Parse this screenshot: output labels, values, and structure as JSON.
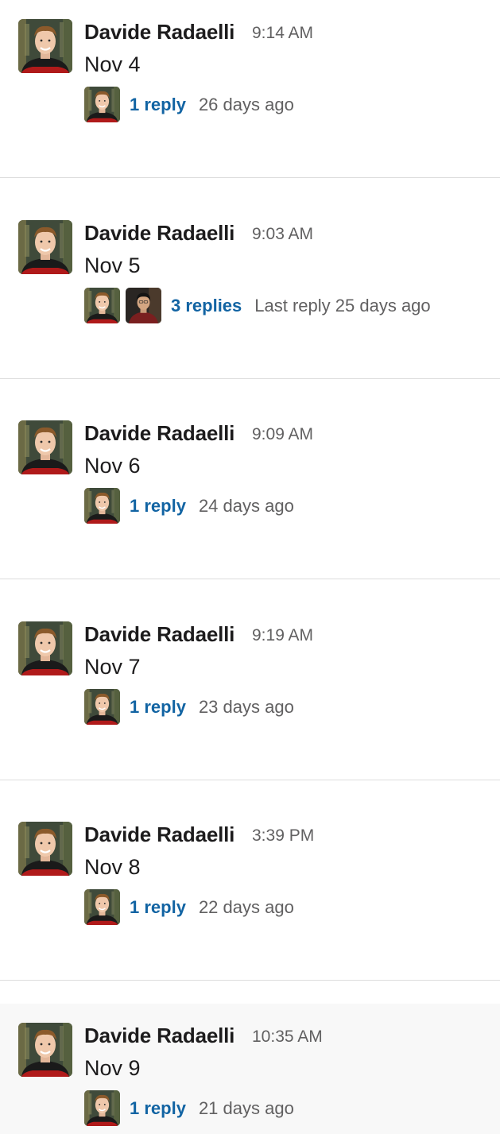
{
  "messages": [
    {
      "author": "Davide Radaelli",
      "time": "9:14 AM",
      "text": "Nov 4",
      "replies": "1 reply",
      "reply_meta": "26 days ago",
      "participants": [
        "davide"
      ]
    },
    {
      "author": "Davide Radaelli",
      "time": "9:03 AM",
      "text": "Nov 5",
      "replies": "3 replies",
      "reply_meta": "Last reply 25 days ago",
      "participants": [
        "davide",
        "other"
      ]
    },
    {
      "author": "Davide Radaelli",
      "time": "9:09 AM",
      "text": "Nov 6",
      "replies": "1 reply",
      "reply_meta": "24 days ago",
      "participants": [
        "davide"
      ]
    },
    {
      "author": "Davide Radaelli",
      "time": "9:19 AM",
      "text": "Nov 7",
      "replies": "1 reply",
      "reply_meta": "23 days ago",
      "participants": [
        "davide"
      ]
    },
    {
      "author": "Davide Radaelli",
      "time": "3:39 PM",
      "text": "Nov 8",
      "replies": "1 reply",
      "reply_meta": "22 days ago",
      "participants": [
        "davide"
      ]
    },
    {
      "author": "Davide Radaelli",
      "time": "10:35 AM",
      "text": "Nov 9",
      "replies": "1 reply",
      "reply_meta": "21 days ago",
      "participants": [
        "davide"
      ]
    }
  ],
  "colors": {
    "link": "#1264a3",
    "muted": "#616061",
    "text": "#1d1c1d",
    "highlight_bg": "#f8f8f8",
    "divider": "#dddddd"
  }
}
